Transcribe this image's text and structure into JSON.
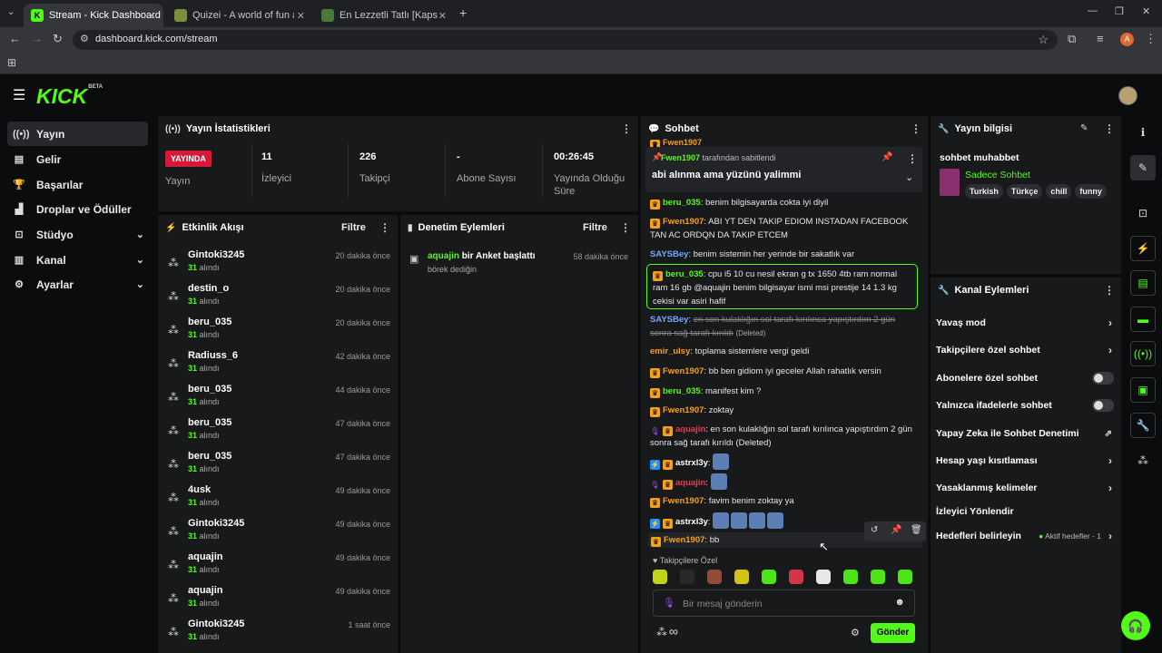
{
  "browser": {
    "tabs": [
      {
        "title": "Stream - Kick Dashboard",
        "active": true
      },
      {
        "title": "Quizei - A world of fun and inter",
        "active": false
      },
      {
        "title": "En Lezzetli Tatlı [Kapsamlı] - Tie",
        "active": false
      }
    ],
    "url": "dashboard.kick.com/stream",
    "profile_initial": "A"
  },
  "header": {
    "logo": "KICK",
    "logo_badge": "BETA"
  },
  "nav": {
    "items": [
      {
        "label": "Yayın",
        "icon": "broadcast-icon"
      },
      {
        "label": "Gelir",
        "icon": "revenue-icon"
      },
      {
        "label": "Başarılar",
        "icon": "trophy-icon"
      },
      {
        "label": "Droplar ve Ödüller",
        "icon": "gift-icon"
      },
      {
        "label": "Stüdyo",
        "icon": "studio-icon"
      },
      {
        "label": "Kanal",
        "icon": "channel-icon"
      },
      {
        "label": "Ayarlar",
        "icon": "gear-icon"
      }
    ]
  },
  "stats": {
    "title": "Yayın İstatistikleri",
    "live_badge": "YAYINDA",
    "live_label": "Yayın",
    "viewers_value": "11",
    "viewers_label": "İzleyici",
    "followers_value": "226",
    "followers_label": "Takipçi",
    "subs_value": "-",
    "subs_label": "Abone Sayısı",
    "uptime_value": "00:26:45",
    "uptime_label_1": "Yayında Olduğu",
    "uptime_label_2": "Süre"
  },
  "activity": {
    "title": "Etkinlik Akışı",
    "filter": "Filtre",
    "rows": [
      {
        "name": "Gintoki3245",
        "count": "31",
        "suffix": "alındı",
        "time": "20 dakika önce"
      },
      {
        "name": "destin_o",
        "count": "31",
        "suffix": "alındı",
        "time": "20 dakika önce"
      },
      {
        "name": "beru_035",
        "count": "31",
        "suffix": "alındı",
        "time": "20 dakika önce"
      },
      {
        "name": "Radiuss_6",
        "count": "31",
        "suffix": "alındı",
        "time": "42 dakika önce"
      },
      {
        "name": "beru_035",
        "count": "31",
        "suffix": "alındı",
        "time": "44 dakika önce"
      },
      {
        "name": "beru_035",
        "count": "31",
        "suffix": "alındı",
        "time": "47 dakika önce"
      },
      {
        "name": "beru_035",
        "count": "31",
        "suffix": "alındı",
        "time": "47 dakika önce"
      },
      {
        "name": "4usk",
        "count": "31",
        "suffix": "alındı",
        "time": "49 dakika önce"
      },
      {
        "name": "Gintoki3245",
        "count": "31",
        "suffix": "alındı",
        "time": "49 dakika önce"
      },
      {
        "name": "aquajin",
        "count": "31",
        "suffix": "alındı",
        "time": "49 dakika önce"
      },
      {
        "name": "aquajin",
        "count": "31",
        "suffix": "alındı",
        "time": "49 dakika önce"
      },
      {
        "name": "Gintoki3245",
        "count": "31",
        "suffix": "alındı",
        "time": "1 saat önce"
      }
    ]
  },
  "moderation": {
    "title": "Denetim Eylemleri",
    "filter": "Filtre",
    "entry_user": "aquajin",
    "entry_action": "bir Anket başlattı",
    "entry_detail": "börek dediğin",
    "entry_time": "58 dakika önce"
  },
  "chat": {
    "title": "Sohbet",
    "pinned_by_user": "Fwen1907",
    "pinned_by_text": "tarafından sabitlendi",
    "pinned_text": "abi alınma ama yüzünü yalimmi",
    "partial_top_user": "Fwen1907",
    "messages": [
      {
        "user": "beru_035",
        "text": ": benim bilgisayarda cokta iyi diyil"
      },
      {
        "user": "Fwen1907",
        "text": ": ABI YT DEN TAKIP EDIOM INSTADAN FACEBOOK TAN AC ORDQN DA TAKIP ETCEM"
      },
      {
        "user": "SAYSBey",
        "text": ": benim sistemin her yerinde bir sakatlık var"
      },
      {
        "user": "beru_035",
        "text": ": cpu i5 10 cu nesil ekran g tx 1650 4tb ram normal ram 16 gb @aquajin benim bilgisayar ismi msi prestije 14 1.3 kg cekisi var asiri hafif"
      },
      {
        "user": "SAYSBey",
        "deleted_text": "en son kulaklığın sol tarafı kırılınca yapıştırdım 2 gün sonra sağ tarafı kırıldı",
        "deleted_tag": "(Deleted)"
      },
      {
        "user": "emir_ulsy",
        "text": ": toplama sistemlere vergi geldi"
      },
      {
        "user": "Fwen1907",
        "text": ": bb ben gidiom iyi geceler Allah rahatlık versin"
      },
      {
        "user": "beru_035",
        "text": ": manifest kim ?"
      },
      {
        "user": "Fwen1907",
        "text": ": zoktay"
      },
      {
        "user": "aquajin",
        "text": ": en son kulaklığın sol tarafı kırılınca yapıştırdım 2 gün sonra sağ tarafı kırıldı (Deleted)"
      },
      {
        "user": "astrxl3y",
        "text": ":"
      },
      {
        "user": "aquajin",
        "text": ":"
      },
      {
        "user": "Fwen1907",
        "text": ": favim benim zoktay ya"
      },
      {
        "user": "astrxl3y",
        "text": ":"
      },
      {
        "user": "Fwen1907",
        "text": ": bb"
      }
    ],
    "followers_only_label": "Takipçilere Özel",
    "input_placeholder": "Bir mesaj gönderin",
    "send_label": "Gönder",
    "infinity_label": "∞"
  },
  "stream_info": {
    "title": "Yayın bilgisi",
    "stream_title": "sohbet muhabbet",
    "category": "Sadece Sohbet",
    "tags": [
      "Turkish",
      "Türkçe",
      "chill",
      "funny"
    ]
  },
  "channel_actions": {
    "title": "Kanal Eylemleri",
    "slow_mode": "Yavaş mod",
    "followers_chat": "Takipçilere özel sohbet",
    "subscribers_chat": "Abonelere özel sohbet",
    "emotes_chat": "Yalnızca ifadelerle sohbet",
    "ai_moderation": "Yapay Zeka ile Sohbet Denetimi",
    "age_restriction": "Hesap yaşı kısıtlaması",
    "banned_words": "Yasaklanmış kelimeler",
    "raid": "İzleyici Yönlendir",
    "goals": "Hedefleri belirleyin",
    "goals_status": "Aktif hedefler - 1"
  },
  "colors": {
    "accent": "#53fc18",
    "live": "#d4193b",
    "panel": "#18191b"
  }
}
